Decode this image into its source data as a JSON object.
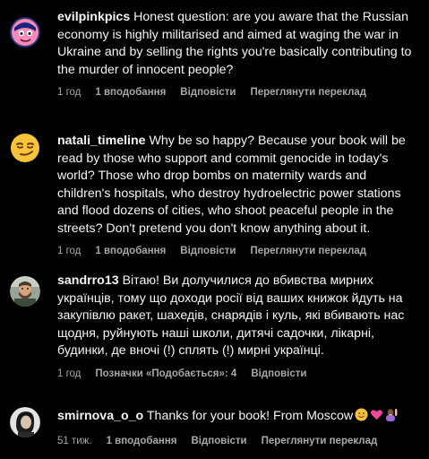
{
  "comments": [
    {
      "username": "evilpinkpics",
      "text": "Honest question: are you aware that the Russian economy is highly militarised and aimed at waging the war in Ukraine and by selling the rights you're basically contributing to the murder of innocent people?",
      "time": "1 год",
      "likes": "1 вподобання",
      "reply": "Відповісти",
      "translate": "Переглянути переклад",
      "avatar_icon": "cartoon-face-avatar-icon"
    },
    {
      "username": "natali_timeline",
      "text": "Why be so happy? Because your book will be read by those who support and commit genocide in today's world? Those who drop bombs on maternity wards and children's hospitals, who destroy hydroelectric power stations and flood dozens of cities, who shoot peaceful people in the streets? Don't pretend you don't know anything about it.",
      "time": "1 год",
      "likes": "1 вподобання",
      "reply": "Відповісти",
      "translate": "Переглянути переклад",
      "avatar_icon": "smirk-emoji-avatar-icon"
    },
    {
      "username": "sandrro13",
      "text": "Вітаю! Ви долучилися до вбивства мирних українців, тому що доходи росії від ваших книжок йдуть на закупівлю ракет, шахедів, снарядів і куль, які вбивають нас щодня, руйнують наші школи, дитячі садочки, лікарні, будинки, де вночі (!) сплять (!) мирні українці.",
      "time": "1 год",
      "likes": "Позначки «Подобається»: 4",
      "reply": "Відповісти",
      "translate": "",
      "avatar_icon": "bearded-man-avatar-icon"
    },
    {
      "username": "smirnova_o_o",
      "text": "Thanks for your book! From Moscow",
      "time": "51 тиж.",
      "likes": "1 вподобання",
      "reply": "Відповісти",
      "translate": "Переглянути переклад",
      "avatar_icon": "woman-photo-avatar-icon",
      "trailing_emojis": [
        "smile-emoji-icon",
        "pink-heart-emoji-icon",
        "woman-raising-hand-emoji-icon"
      ]
    }
  ],
  "colors": {
    "background": "#000000",
    "text": "#f5f5f5",
    "meta": "#a8a8a8"
  }
}
